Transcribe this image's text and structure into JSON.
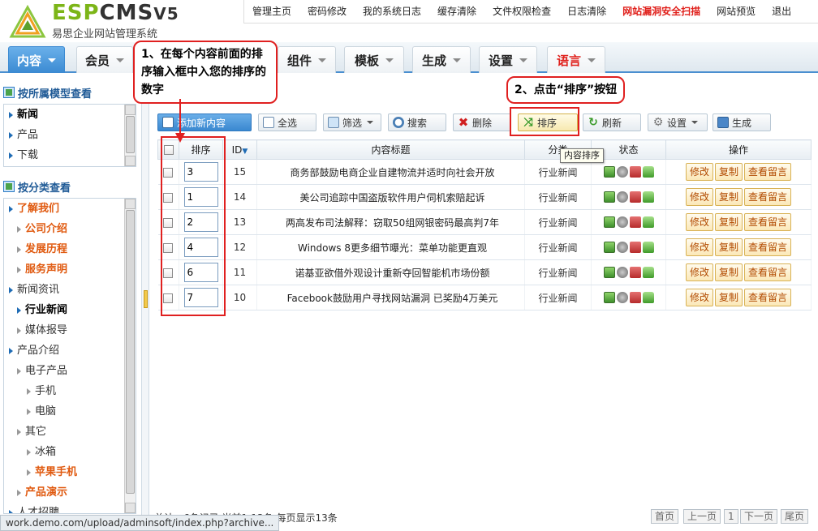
{
  "logo": {
    "brand_green": "ESP",
    "brand_dark": "CMS",
    "version": "V5",
    "subtitle": "易思企业网站管理系统"
  },
  "topnav": [
    "管理主页",
    "密码修改",
    "我的系统日志",
    "缓存清除",
    "文件权限检查",
    "日志清除",
    "网站漏洞安全扫描",
    "网站预览",
    "退出"
  ],
  "tabs": [
    "内容",
    "会员",
    "组件",
    "模板",
    "生成",
    "设置",
    "语言"
  ],
  "sidebar": {
    "model_title": "按所属模型查看",
    "models": [
      "新闻",
      "产品",
      "下载"
    ],
    "category_title": "按分类查看",
    "categories": [
      "了解我们",
      "公司介绍",
      "发展历程",
      "服务声明",
      "新闻资讯",
      "行业新闻",
      "媒体报导",
      "产品介绍",
      "电子产品",
      "手机",
      "电脑",
      "其它",
      "冰箱",
      "苹果手机",
      "产品演示",
      "人才招聘"
    ]
  },
  "toolbar": {
    "add": "添加新内容",
    "select_all": "全选",
    "filter": "筛选",
    "search": "搜索",
    "delete": "删除",
    "sort": "排序",
    "refresh": "刷新",
    "settings": "设置",
    "generate": "生成"
  },
  "table": {
    "headers": {
      "sort": "排序",
      "id": "ID",
      "title": "内容标题",
      "category": "分类",
      "status": "状态",
      "ops": "操作"
    },
    "rows": [
      {
        "order": "3",
        "id": "15",
        "title": "商务部鼓励电商企业自建物流并适时向社会开放",
        "category": "行业新闻"
      },
      {
        "order": "1",
        "id": "14",
        "title": "美公司追踪中国盗版软件用户伺机索赔起诉",
        "category": "行业新闻"
      },
      {
        "order": "2",
        "id": "13",
        "title": "两高发布司法解释：窃取50组网银密码最高判7年",
        "category": "行业新闻"
      },
      {
        "order": "4",
        "id": "12",
        "title": "Windows 8更多细节曝光：菜单功能更直观",
        "category": "行业新闻"
      },
      {
        "order": "6",
        "id": "11",
        "title": "诺基亚欲借外观设计重新夺回智能机市场份额",
        "category": "行业新闻"
      },
      {
        "order": "7",
        "id": "10",
        "title": "Facebook鼓励用户寻找网站漏洞 已奖励4万美元",
        "category": "行业新闻"
      }
    ],
    "ops": {
      "edit": "修改",
      "copy": "复制",
      "comments": "查看留言"
    }
  },
  "pager": {
    "summary": "总计：6条记录 当前1-13条 每页显示13条",
    "first": "首页",
    "prev": "上一页",
    "page": "1",
    "next": "下一页",
    "last": "尾页"
  },
  "tooltip": "内容排序",
  "annotations": {
    "step1": "1、在每个内容前面的排序输入框中入您的排序的数字",
    "step2": "2、点击“排序”按钮"
  },
  "statusbar": "work.demo.com/upload/adminsoft/index.php?archive..."
}
